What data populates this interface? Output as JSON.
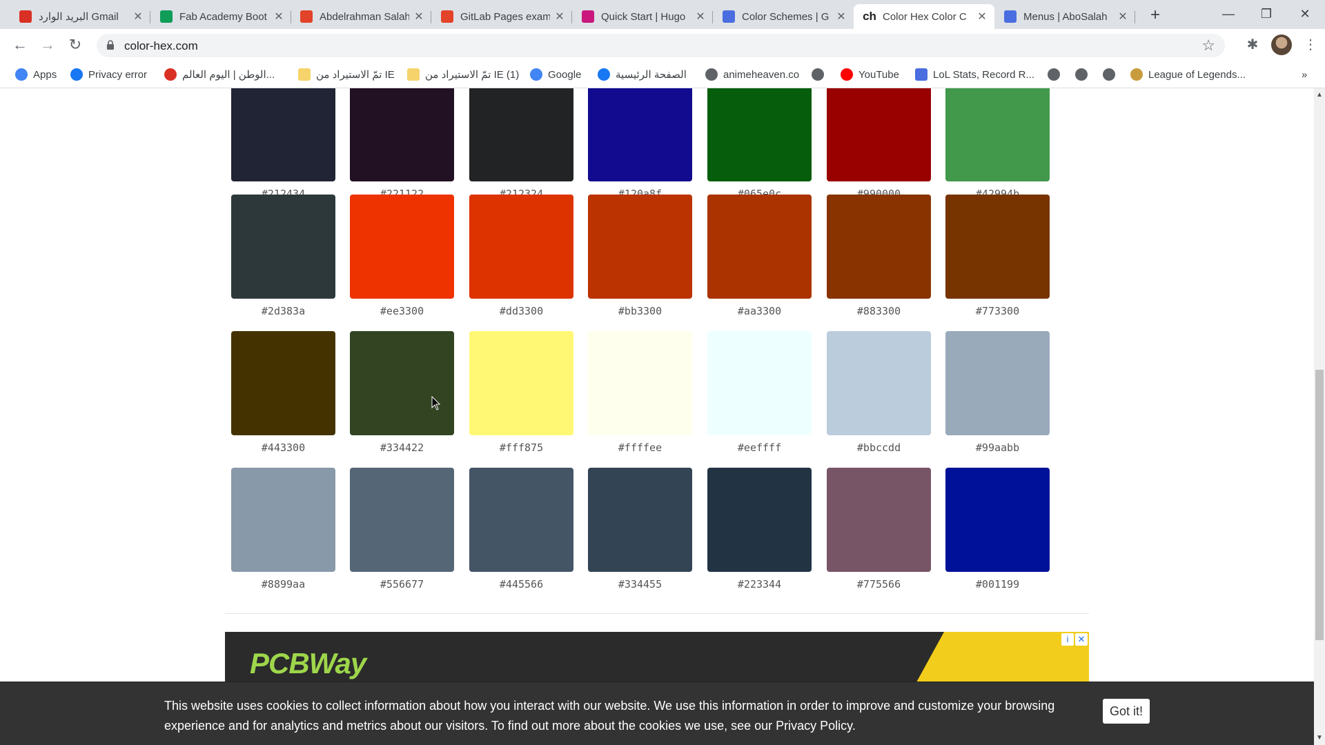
{
  "browser": {
    "tabs": [
      {
        "title": "البريد الوارد Gmail",
        "icon": "gmail-icon",
        "color": "#d93025"
      },
      {
        "title": "Fab Academy Boot",
        "icon": "sheets-icon",
        "color": "#0f9d58"
      },
      {
        "title": "Abdelrahman Salah",
        "icon": "gitlab-icon",
        "color": "#e24329"
      },
      {
        "title": "GitLab Pages exam",
        "icon": "gitlab-icon",
        "color": "#e24329"
      },
      {
        "title": "Quick Start | Hugo",
        "icon": "hugo-icon",
        "color": "#c9177e"
      },
      {
        "title": "Color Schemes | G",
        "icon": "page-icon",
        "color": "#4a6ee0"
      },
      {
        "title": "Color Hex Color C",
        "icon": "colorhex-icon",
        "color": "#333333",
        "favtext": "ch"
      },
      {
        "title": "Menus | AboSalah",
        "icon": "page-icon",
        "color": "#4a6ee0"
      }
    ],
    "active_tab": 6,
    "url": "color-hex.com",
    "bookmarks": [
      {
        "label": "Apps",
        "icon": "apps-icon",
        "color": "#4285f4"
      },
      {
        "label": "Privacy error",
        "icon": "facebook-icon",
        "color": "#1877f2"
      },
      {
        "label": "الوطن | اليوم العالم...",
        "icon": "alwatan-icon",
        "color": "#d93025"
      },
      {
        "label": "تمّ الاستيراد من IE",
        "icon": "folder-icon",
        "color": "#f6d36b"
      },
      {
        "label": "تمّ الاستيراد من IE (1)",
        "icon": "folder-icon",
        "color": "#f6d36b"
      },
      {
        "label": "Google",
        "icon": "google-icon",
        "color": "#4285f4"
      },
      {
        "label": "الصفحة الرئيسية",
        "icon": "facebook-icon",
        "color": "#1877f2"
      },
      {
        "label": "animeheaven.co",
        "icon": "globe-icon",
        "color": "#5f6368"
      },
      {
        "label": "",
        "icon": "globe-icon",
        "color": "#5f6368"
      },
      {
        "label": "YouTube",
        "icon": "youtube-icon",
        "color": "#ff0000"
      },
      {
        "label": "LoL Stats, Record R...",
        "icon": "lol-stats-icon",
        "color": "#4a6ee0"
      },
      {
        "label": "",
        "icon": "globe-icon",
        "color": "#5f6368"
      },
      {
        "label": "",
        "icon": "globe-icon",
        "color": "#5f6368"
      },
      {
        "label": "",
        "icon": "globe-icon",
        "color": "#5f6368"
      },
      {
        "label": "League of Legends...",
        "icon": "league-icon",
        "color": "#c89b3c"
      }
    ]
  },
  "swatches": [
    {
      "hex": "#212434",
      "label": "#212434"
    },
    {
      "hex": "#221122",
      "label": "#221122"
    },
    {
      "hex": "#212324",
      "label": "#212324"
    },
    {
      "hex": "#120a8f",
      "label": "#120a8f"
    },
    {
      "hex": "#065e0c",
      "label": "#065e0c"
    },
    {
      "hex": "#990000",
      "label": "#990000"
    },
    {
      "hex": "#42994b",
      "label": "#42994b"
    },
    {
      "hex": "#2d383a",
      "label": "#2d383a"
    },
    {
      "hex": "#ee3300",
      "label": "#ee3300"
    },
    {
      "hex": "#dd3300",
      "label": "#dd3300"
    },
    {
      "hex": "#bb3300",
      "label": "#bb3300"
    },
    {
      "hex": "#aa3300",
      "label": "#aa3300"
    },
    {
      "hex": "#883300",
      "label": "#883300"
    },
    {
      "hex": "#773300",
      "label": "#773300"
    },
    {
      "hex": "#443300",
      "label": "#443300"
    },
    {
      "hex": "#334422",
      "label": "#334422"
    },
    {
      "hex": "#fff875",
      "label": "#fff875"
    },
    {
      "hex": "#ffffee",
      "label": "#ffffee"
    },
    {
      "hex": "#eeffff",
      "label": "#eeffff"
    },
    {
      "hex": "#bbccdd",
      "label": "#bbccdd"
    },
    {
      "hex": "#99aabb",
      "label": "#99aabb"
    },
    {
      "hex": "#8899aa",
      "label": "#8899aa"
    },
    {
      "hex": "#556677",
      "label": "#556677"
    },
    {
      "hex": "#445566",
      "label": "#445566"
    },
    {
      "hex": "#334455",
      "label": "#334455"
    },
    {
      "hex": "#223344",
      "label": "#223344"
    },
    {
      "hex": "#775566",
      "label": "#775566"
    },
    {
      "hex": "#001199",
      "label": "#001199"
    }
  ],
  "ad": {
    "brand": "PCBWay",
    "info_icon": "i",
    "close_icon": "✕"
  },
  "cookie": {
    "message": "This website uses cookies to collect information about how you interact with our website. We use this information in order to improve and customize your browsing experience and for analytics and metrics about our visitors. To find out more about the cookies we use, see our ",
    "link": "Privacy Policy",
    "end": ".",
    "button": "Got it!"
  }
}
